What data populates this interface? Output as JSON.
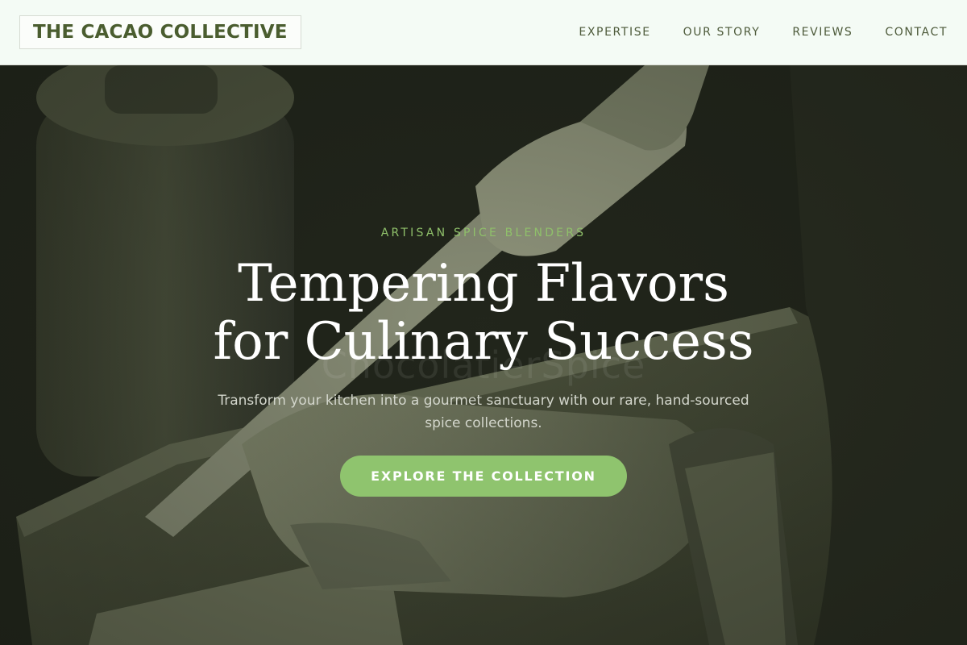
{
  "navbar": {
    "logo": "THE CACAO COLLECTIVE",
    "links": [
      "EXPERTISE",
      "OUR STORY",
      "REVIEWS",
      "CONTACT"
    ]
  },
  "hero": {
    "eyebrow": "ARTISAN SPICE BLENDERS",
    "watermark": "ChocolatierSpice",
    "headline": "Tempering Flavors for Culinary Success",
    "subtext": "Transform your kitchen into a gourmet sanctuary with our rare, hand-sourced spice collections.",
    "cta_label": "EXPLORE THE COLLECTION"
  },
  "colors": {
    "navbar_bg": "#f4fbf5",
    "logo_text": "#4a5d2f",
    "accent_green": "#8fc46e",
    "hero_dark": "#23271d"
  }
}
